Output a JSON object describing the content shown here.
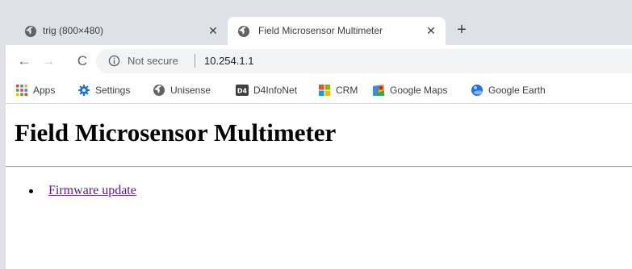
{
  "tabs": [
    {
      "title": "trig (800×480)",
      "active": false,
      "close": "✕"
    },
    {
      "title": "Field Microsensor Multimeter",
      "active": true,
      "close": "✕"
    }
  ],
  "new_tab_label": "+",
  "toolbar": {
    "back": "←",
    "forward": "→",
    "reload": "C",
    "security_label": "Not secure",
    "url": "10.254.1.1"
  },
  "bookmarks": [
    {
      "label": "Apps",
      "icon": "apps-grid-icon"
    },
    {
      "label": "Settings",
      "icon": "gear-icon"
    },
    {
      "label": "Unisense",
      "icon": "globe-icon"
    },
    {
      "label": "D4InfoNet",
      "icon": "d4-icon",
      "icon_text": "D4"
    },
    {
      "label": "CRM",
      "icon": "crm-windows-icon"
    },
    {
      "label": "Google Maps",
      "icon": "google-maps-icon"
    },
    {
      "label": "Google Earth",
      "icon": "google-earth-icon"
    }
  ],
  "page": {
    "heading": "Field Microsensor Multimeter",
    "links": [
      {
        "label": "Firmware update"
      }
    ]
  },
  "colors": {
    "tabstrip": "#dee1e6",
    "omnibox": "#f1f3f4",
    "visited_link": "#551a8b",
    "chrome_icon": "#5f6368"
  }
}
